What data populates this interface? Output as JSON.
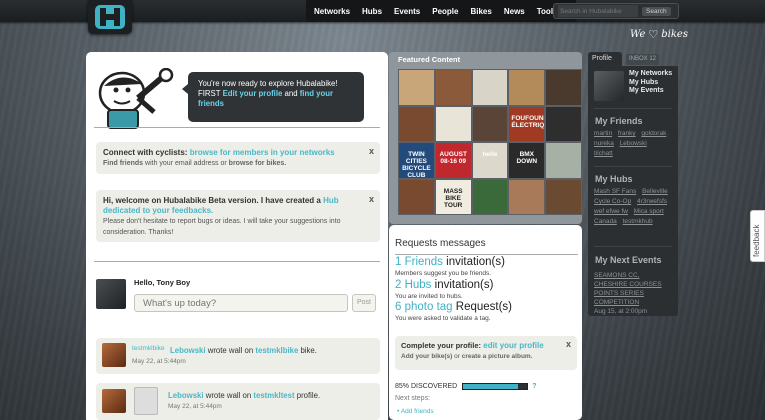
{
  "nav": {
    "items": [
      "Networks",
      "Hubs",
      "Events",
      "People",
      "Bikes",
      "News",
      "Tools"
    ],
    "search_placeholder": "Search in Hubalabike",
    "search_button": "Search"
  },
  "tagline": {
    "pre": "We",
    "post": "bikes"
  },
  "intro": {
    "line1": "You're now ready to explore Hubalabike!",
    "first": "FIRST",
    "edit_profile": "Edit your profile",
    "and": "and",
    "find_friends": "find your friends"
  },
  "connect_box": {
    "title": "Connect with cyclists:",
    "browse_members": "browse for members in your networks",
    "find_friends": "Find friends",
    "with_email": "with your email address or",
    "browse_bikes": "browse for bikes."
  },
  "welcome_box": {
    "text": "Hi, welcome on Hubalabike Beta version. I have created a",
    "hub_link": "Hub dedicated to your feedbacks.",
    "sub": "Please don't hesitate to report bugs or ideas. I will take your suggestions into consideration. Thanks!"
  },
  "composer": {
    "hello": "Hello, Tony Boy",
    "placeholder": "What's up today?",
    "post": "Post"
  },
  "wall": [
    {
      "user": "testmklbike",
      "actor": "Lebowski",
      "verb": "wrote wall on",
      "target": "testmklbike",
      "suffix": "bike.",
      "date": "May 22, at 5:44pm"
    },
    {
      "user": "",
      "actor": "Lebowski",
      "verb": "wrote wall on",
      "target": "testmkltest",
      "suffix": "profile.",
      "date": "May 22, at 5:44pm"
    }
  ],
  "featured": {
    "title": "Featured Content",
    "tiles": [
      "",
      "",
      "",
      "",
      "",
      "",
      "",
      "",
      "FOUFOUNES ÉLECTRIQUES",
      "",
      "TWIN CITIES BICYCLE CLUB",
      "AUGUST 08-16 09",
      "helle",
      "BMX DOWN",
      "",
      "",
      "MASS BIKE TOUR",
      "",
      "",
      ""
    ]
  },
  "requests": {
    "title": "Requests messages",
    "items": [
      {
        "count": "1 Friends",
        "label": "invitation(s)",
        "sub": "Members suggest you be friends."
      },
      {
        "count": "2 Hubs",
        "label": "invitation(s)",
        "sub": "You are invited to hubs."
      },
      {
        "count": "6 photo tag",
        "label": "Request(s)",
        "sub": "You were asked to validate a tag."
      }
    ]
  },
  "complete_box": {
    "title": "Complete your profile:",
    "edit": "edit your profile",
    "add_bikes": "Add your bike(s)",
    "or": "or",
    "create_album": "create a picture album."
  },
  "progress": {
    "label": "85% DISCOVERED",
    "value": 0.85,
    "help": "?"
  },
  "next": {
    "title": "Next steps:",
    "add_friends": "Add friends"
  },
  "right_panel": {
    "tab_profile": "Profile",
    "tab_inbox": "INBOX 12",
    "my_links": [
      "My Networks",
      "My Hubs",
      "My Events"
    ],
    "friends_title": "My Friends",
    "friends": [
      "martin",
      "franky",
      "goldorak",
      "nureka",
      "Lebowski",
      "tilchatt"
    ],
    "hubs_title": "My Hubs",
    "hubs": [
      "Mash SF Fans",
      "Belleville Cycle Co-Op",
      "4r3rwefsfs",
      "wef efwe fw",
      "Mica sport Canada",
      "testmkhub"
    ],
    "events_title": "My Next Events",
    "event_name": "SEAMONS CC, CHESHIRE COURSES POINTS SERIES COMPETITION",
    "event_date": "Aug 15, at 2:00pm"
  },
  "feedback": "feedback",
  "colors": {
    "accent": "#3fb2c6",
    "dark": "#2b2f32",
    "box": "#eceee7"
  }
}
